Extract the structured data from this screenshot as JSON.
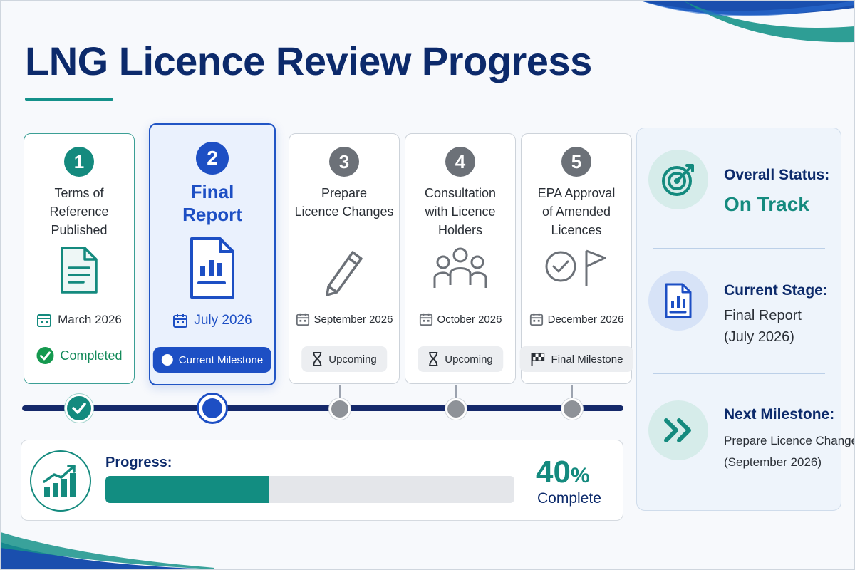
{
  "title": "LNG Licence Review Progress",
  "colors": {
    "navy": "#0c2a6b",
    "teal": "#148a7e",
    "blue": "#1d4fc4",
    "grey": "#6c7178"
  },
  "milestones": [
    {
      "number": "1",
      "label_lines": [
        "Terms of",
        "Reference",
        "Published"
      ],
      "date": "March 2026",
      "status": "Completed",
      "icon": "document-icon"
    },
    {
      "number": "2",
      "label_lines": [
        "Final",
        "Report"
      ],
      "date": "July 2026",
      "status": "Current Milestone",
      "icon": "report-chart-icon"
    },
    {
      "number": "3",
      "label_lines": [
        "Prepare",
        "Licence Changes"
      ],
      "date": "September 2026",
      "status": "Upcoming",
      "icon": "pencil-icon"
    },
    {
      "number": "4",
      "label_lines": [
        "Consultation",
        "with Licence",
        "Holders"
      ],
      "date": "October 2026",
      "status": "Upcoming",
      "icon": "people-icon"
    },
    {
      "number": "5",
      "label_lines": [
        "EPA Approval",
        "of Amended",
        "Licences"
      ],
      "date": "December 2026",
      "status": "Final Milestone",
      "icon": "approval-flag-icon"
    }
  ],
  "progress": {
    "label": "Progress:",
    "percent_number": "40",
    "percent_symbol": "%",
    "fraction": 0.4,
    "complete_label": "Complete"
  },
  "status_panel": {
    "overall": {
      "heading": "Overall Status:",
      "value": "On Track",
      "icon": "target-icon"
    },
    "current": {
      "heading": "Current Stage:",
      "value_lines": [
        "Final Report",
        "(July 2026)"
      ],
      "icon": "report-chart-icon"
    },
    "next": {
      "heading": "Next Milestone:",
      "value_lines": [
        "Prepare Licence Changes",
        "(September 2026)"
      ],
      "icon": "double-chevron-icon"
    }
  }
}
